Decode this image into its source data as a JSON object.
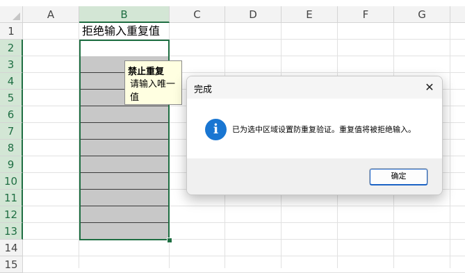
{
  "sheet": {
    "columns": [
      "A",
      "B",
      "C",
      "D",
      "E",
      "F",
      "G"
    ],
    "rows": [
      "1",
      "2",
      "3",
      "4",
      "5",
      "6",
      "7",
      "8",
      "9",
      "10",
      "11",
      "12",
      "13",
      "14",
      "15"
    ],
    "cell_b1": "拒绝输入重复值",
    "selected_column": "B",
    "colors": {
      "selection": "#1e6e42",
      "header_selected_bg": "#d3e6d5",
      "filled_cell": "#c8c8c8"
    }
  },
  "tooltip": {
    "title": "禁止重复",
    "message": "请输入唯一值"
  },
  "dialog": {
    "title": "完成",
    "close_glyph": "✕",
    "info_glyph": "i",
    "message": "已为选中区域设置防重复验证。重复值将被拒绝输入。",
    "ok_label": "确定",
    "colors": {
      "info_icon": "#1976d2",
      "button_accent": "#1a62c5"
    }
  }
}
